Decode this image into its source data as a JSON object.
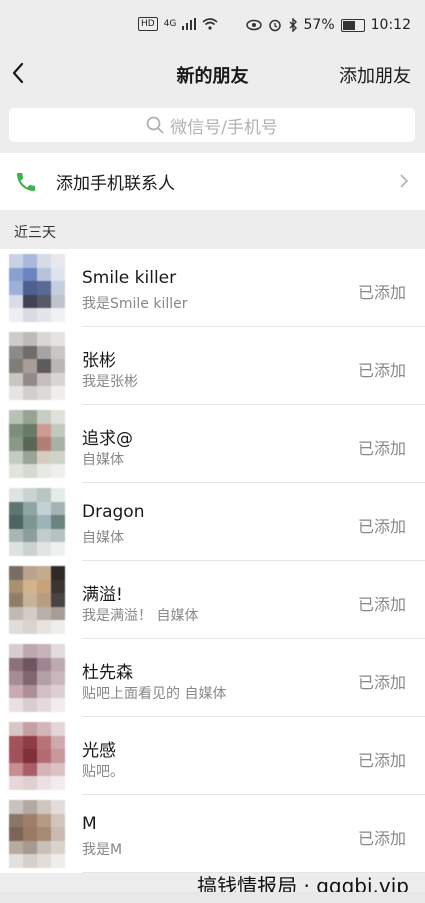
{
  "status_bar": {
    "network_badge": "HD",
    "network_type": "4G",
    "battery": "57%",
    "time": "10:12"
  },
  "header": {
    "title": "新的朋友",
    "action_label": "添加朋友"
  },
  "search": {
    "placeholder": "微信号/手机号"
  },
  "add_contacts": {
    "label": "添加手机联系人"
  },
  "section": {
    "label": "近三天"
  },
  "friends": [
    {
      "name": "Smile killer",
      "intro": "我是Smile killer",
      "status": "已添加",
      "avatar_colors": [
        "#c9d2e4",
        "#a9b8db",
        "#d6dbe8",
        "#e6e8ee",
        "#8aa0cf",
        "#6c84c0",
        "#b7c2de",
        "#dfe3ec",
        "#9fb0d8",
        "#4f5f8e",
        "#5a6a94",
        "#c5cde0",
        "#d7dce7",
        "#3f4254",
        "#555867",
        "#bfc3cc",
        "#eceef2",
        "#d9dbe1",
        "#e3e5ea",
        "#f0f1f3"
      ]
    },
    {
      "name": "张彬",
      "intro": "我是张彬",
      "status": "已添加",
      "avatar_colors": [
        "#cdcccc",
        "#bdbbb8",
        "#d9d7d4",
        "#e4e3e1",
        "#8d8b8a",
        "#6f6c6b",
        "#a7a5a3",
        "#c9c7c4",
        "#7f7c7a",
        "#a79e97",
        "#5e5b5a",
        "#b9b6b3",
        "#c8c6c3",
        "#918c89",
        "#c2bfbc",
        "#d8d6d3",
        "#e6e5e3",
        "#d1cfcc",
        "#dcdad7",
        "#efeeec"
      ]
    },
    {
      "name": "追求@",
      "intro": "自媒体",
      "status": "已添加",
      "avatar_colors": [
        "#b9c0b5",
        "#97a493",
        "#c7cdc3",
        "#dfe2dc",
        "#7d8f7b",
        "#6a7a68",
        "#d09a95",
        "#c1c8bd",
        "#8a9887",
        "#5b6659",
        "#b07f76",
        "#a9b1a5",
        "#c4cbbf",
        "#9aa397",
        "#d7ccc0",
        "#cfd4ca",
        "#e1e4de",
        "#d5d9d0",
        "#e7e9e4",
        "#eff0ec"
      ]
    },
    {
      "name": "Dragon",
      "intro": "自媒体",
      "status": "已添加",
      "avatar_colors": [
        "#dfe4e3",
        "#c9d3d1",
        "#b7c5c3",
        "#e6ebea",
        "#5e7672",
        "#8fa5a1",
        "#c4d1d4",
        "#a3b4b2",
        "#4d6461",
        "#7e9693",
        "#9fb3bb",
        "#6c8380",
        "#a8b7b4",
        "#8d9f9c",
        "#c2cdca",
        "#b5c2bf",
        "#dde2e1",
        "#cbd3d1",
        "#e0e5e4",
        "#eef1f0"
      ]
    },
    {
      "name": "满溢!",
      "intro": "我是满溢！  自媒体",
      "status": "已添加",
      "avatar_colors": [
        "#7a6d63",
        "#b9a38f",
        "#c4ab8c",
        "#2f2a27",
        "#a8916f",
        "#d2b48a",
        "#c9a27a",
        "#3a3532",
        "#8f7d68",
        "#c7b39a",
        "#b89d80",
        "#4a4440",
        "#c1b9b2",
        "#d3ccc5",
        "#b8b0a9",
        "#a59d96",
        "#e1ddda",
        "#d9d4cf",
        "#e6e3e0",
        "#f0eeec"
      ]
    },
    {
      "name": "杜先森",
      "intro": "贴吧上面看见的 自媒体",
      "status": "已添加",
      "avatar_colors": [
        "#d7cdd0",
        "#bda8ae",
        "#c6b4b9",
        "#e3dbdd",
        "#8e7079",
        "#6f5560",
        "#9e8490",
        "#bcaab0",
        "#a58d95",
        "#816670",
        "#b59fa6",
        "#c7b7bc",
        "#caa9b2",
        "#ad8f98",
        "#d2c0c5",
        "#dccfd3",
        "#e8e0e2",
        "#d9cdd0",
        "#e4dadd",
        "#f1ecee"
      ]
    },
    {
      "name": "光感",
      "intro": "贴吧。",
      "status": "已添加",
      "avatar_colors": [
        "#d8c5c6",
        "#c79ea1",
        "#d3b6b8",
        "#e4d5d6",
        "#a4535a",
        "#8e3d45",
        "#b8737a",
        "#d0a9ad",
        "#a05159",
        "#7f3039",
        "#b26d74",
        "#c9989d",
        "#c78d93",
        "#a85e66",
        "#d7b3b7",
        "#dcc2c5",
        "#e6d7d9",
        "#dfcfd1",
        "#ebe1e2",
        "#f2ecec"
      ]
    },
    {
      "name": "M",
      "intro": "我是M",
      "status": "已添加",
      "avatar_colors": [
        "#c8c2bf",
        "#b3a8a2",
        "#cfc5bf",
        "#e2ddda",
        "#8a7566",
        "#a07f6a",
        "#b79a84",
        "#d1c5bd",
        "#7c6556",
        "#9a7a63",
        "#a78a74",
        "#c9bbb1",
        "#b7aaa1",
        "#a89990",
        "#c9bfb8",
        "#d9d2cd",
        "#e4e0dd",
        "#d6d0cb",
        "#e2ddd9",
        "#efecea"
      ]
    }
  ],
  "watermark": "搞钱情报局 · gqqbj.vip"
}
